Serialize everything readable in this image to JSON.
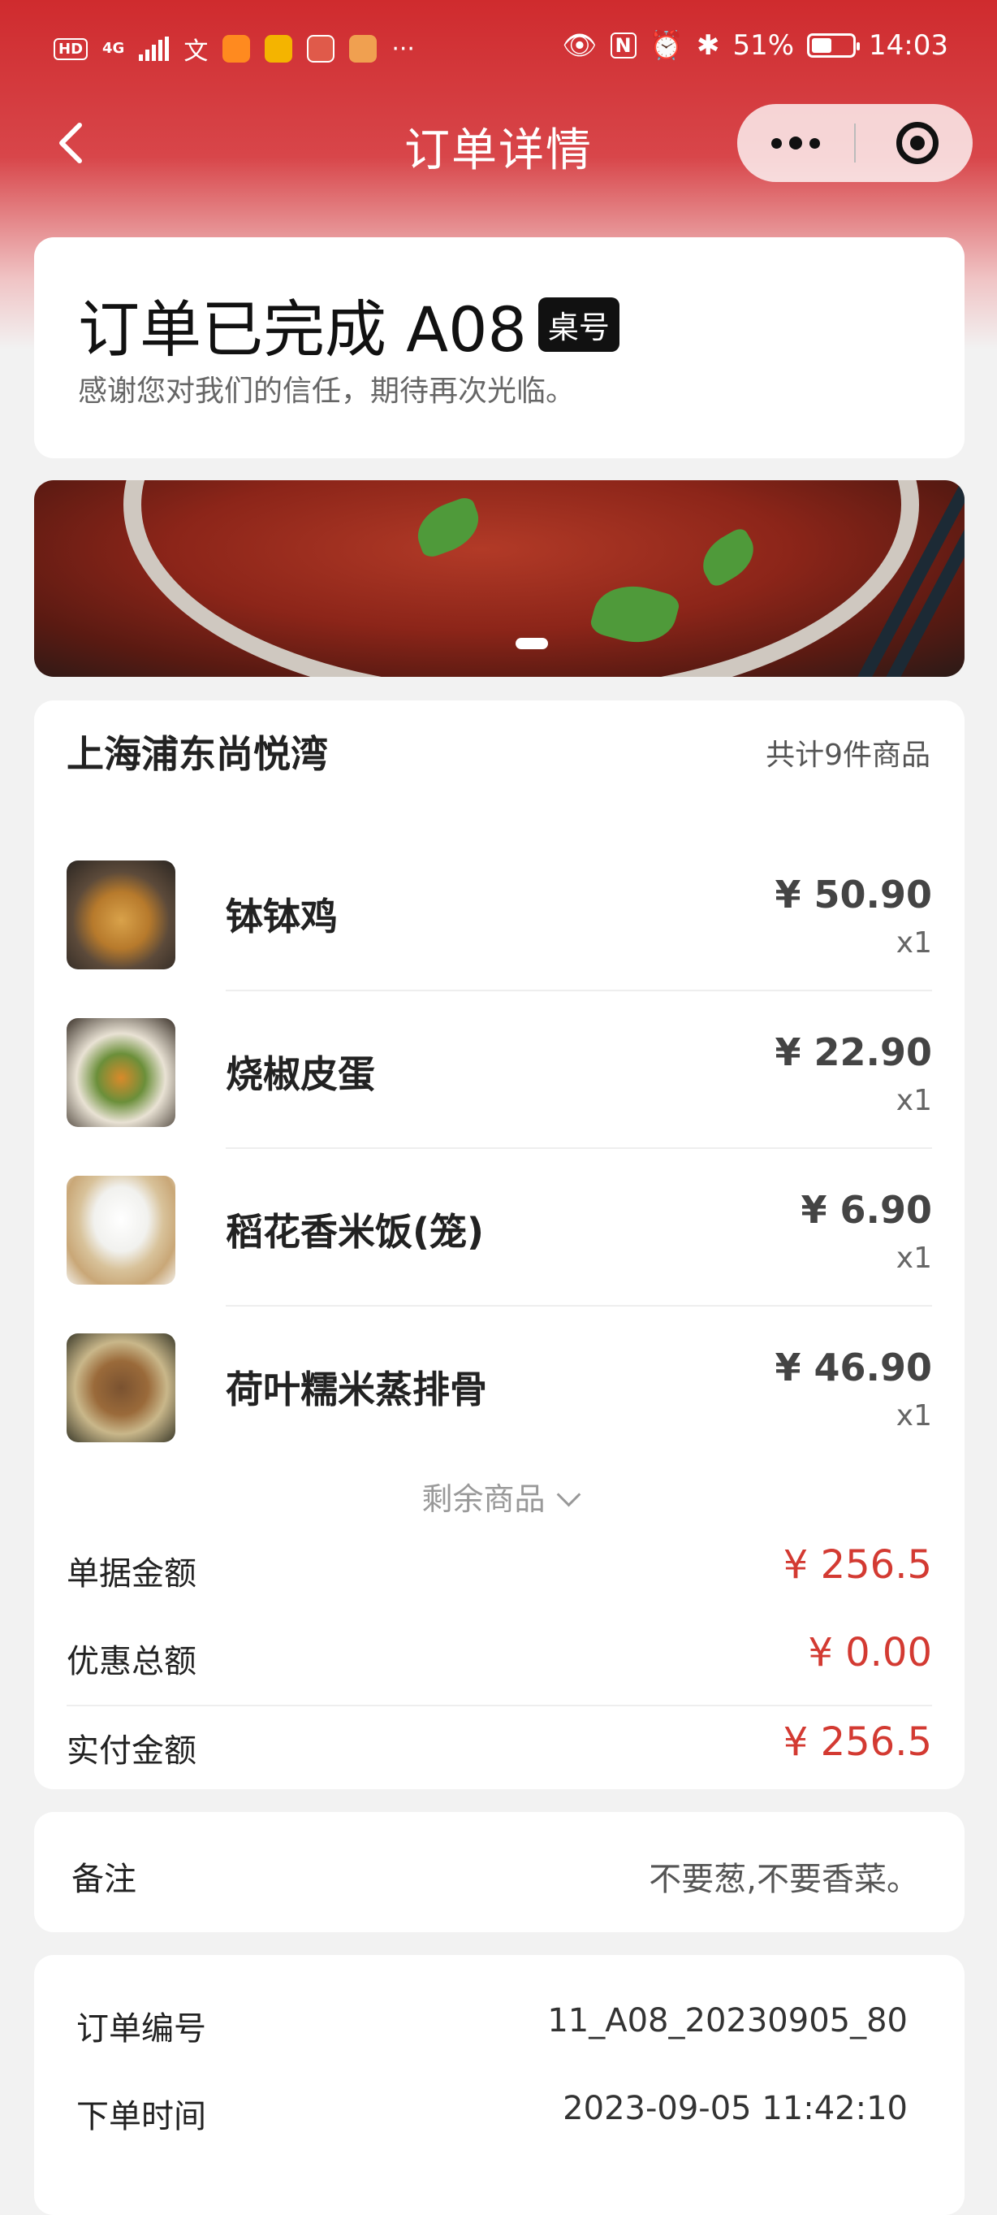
{
  "status_bar": {
    "network": "HD",
    "network_type": "4G",
    "battery": "51%",
    "battery_level": 0.51,
    "time": "14:03",
    "more": "···"
  },
  "nav": {
    "title": "订单详情"
  },
  "order_status": {
    "title": "订单已完成 A08",
    "table_badge": "桌号",
    "subtitle": "感谢您对我们的信任，期待再次光临。"
  },
  "order": {
    "shop_name": "上海浦东尚悦湾",
    "item_count": "共计9件商品",
    "items": [
      {
        "name": "钵钵鸡",
        "price": "¥ 50.90",
        "qty": "x1"
      },
      {
        "name": "烧椒皮蛋",
        "price": "¥ 22.90",
        "qty": "x1"
      },
      {
        "name": "稻花香米饭(笼)",
        "price": "¥ 6.90",
        "qty": "x1"
      },
      {
        "name": "荷叶糯米蒸排骨",
        "price": "¥ 46.90",
        "qty": "x1"
      }
    ],
    "more_items": "剩余商品",
    "summary": {
      "bill_label": "单据金额",
      "bill_value": "¥ 256.5",
      "discount_label": "优惠总额",
      "discount_value": "¥ 0.00",
      "paid_label": "实付金额",
      "paid_value": "¥ 256.5"
    }
  },
  "remark": {
    "label": "备注",
    "value": "不要葱,不要香菜。"
  },
  "info": {
    "order_no_label": "订单编号",
    "order_no_value": "11_A08_20230905_80",
    "order_time_label": "下单时间",
    "order_time_value": "2023-09-05 11:42:10"
  },
  "colors": {
    "header_red": "#cf2b2e",
    "price_red": "#d33a32"
  }
}
